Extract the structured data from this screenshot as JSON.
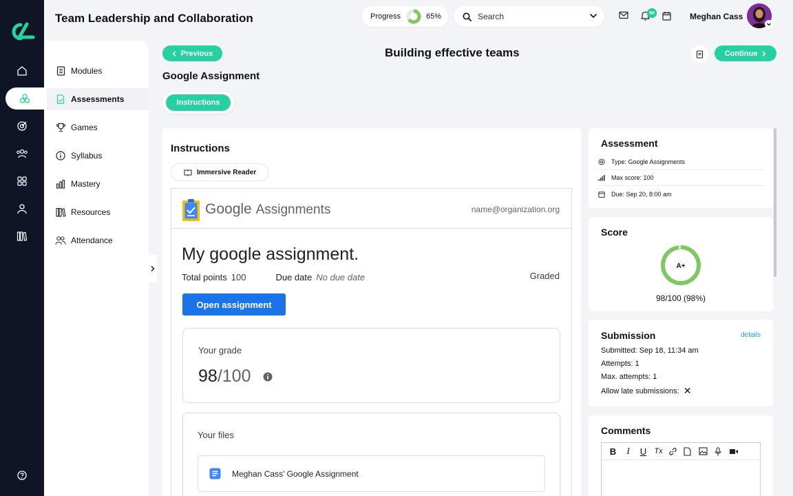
{
  "header": {
    "title": "Team Leadership and Collaboration",
    "progress_label": "Progress",
    "progress_value": "65%",
    "progress_fraction": 0.65,
    "search_placeholder": "Search",
    "notification_count": "50",
    "user_name": "Meghan Cass"
  },
  "rail": {
    "icons": [
      "home-icon",
      "assessments-icon",
      "target-icon",
      "users-icon",
      "apps-icon",
      "profile-icon",
      "library-icon",
      "help-icon"
    ]
  },
  "sidebar": {
    "items": [
      {
        "label": "Modules",
        "icon": "book-icon"
      },
      {
        "label": "Assessments",
        "icon": "document-icon"
      },
      {
        "label": "Games",
        "icon": "trophy-icon"
      },
      {
        "label": "Syllabus",
        "icon": "info-icon"
      },
      {
        "label": "Mastery",
        "icon": "bar-chart-icon"
      },
      {
        "label": "Resources",
        "icon": "library-icon"
      },
      {
        "label": "Attendance",
        "icon": "people-icon"
      }
    ],
    "active_index": 1
  },
  "page": {
    "previous_label": "Previous",
    "continue_label": "Continue",
    "title": "Building effective teams",
    "section_title": "Google Assignment",
    "tab_label": "Instructions"
  },
  "instructions": {
    "heading": "Instructions",
    "immersive_reader": "Immersive Reader",
    "google": {
      "brand_google": "Google",
      "brand_assignments": "Assignments",
      "email": "name@organization.org",
      "assignment_title": "My google assignment.",
      "total_points_label": "Total points",
      "total_points_value": "100",
      "due_date_label": "Due date",
      "due_date_value": "No due date",
      "status": "Graded",
      "open_button": "Open assignment",
      "grade_label": "Your grade",
      "grade_value": "98",
      "grade_total": "/100",
      "files_label": "Your files",
      "file_name": "Meghan Cass' Google Assignment"
    }
  },
  "assessment": {
    "heading": "Assessment",
    "type": "Type: Google Assignments",
    "max_score": "Max score: 100",
    "due": "Due: Sep 20, 8:00 am"
  },
  "score": {
    "heading": "Score",
    "grade": "A+",
    "summary": "98/100 (98%)",
    "fraction": 0.98
  },
  "submission": {
    "heading": "Submission",
    "details_link": "details",
    "submitted": "Submitted: Sep 18, 11:34 am",
    "attempts": "Attempts: 1",
    "max_attempts": "Max. attempts: 1",
    "allow_late": "Allow late submissions:",
    "allow_late_value": "✕"
  },
  "comments": {
    "heading": "Comments",
    "toolbar": [
      "B",
      "I",
      "U",
      "Tx"
    ]
  },
  "colors": {
    "accent": "#27d0a0",
    "rail": "#0d1526",
    "google_blue": "#1a73e8",
    "score_ring": "#7dc860"
  }
}
